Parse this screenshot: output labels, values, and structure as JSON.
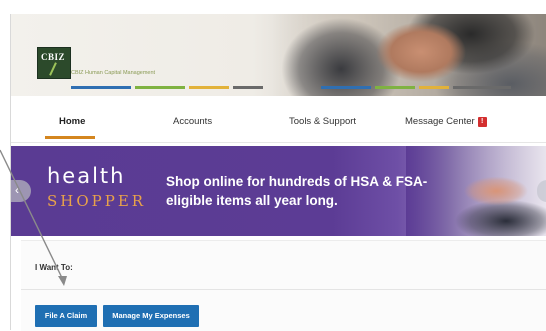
{
  "header": {
    "logo_text": "CBIZ",
    "logo_subtitle": "CBIZ Human Capital Management",
    "stripe_colors": [
      "#2f6fb2",
      "#7fb241",
      "#e2b23a",
      "#6a6a6a",
      "#2f6fb2",
      "#7fb241"
    ]
  },
  "nav": {
    "items": [
      {
        "label": "Home",
        "active": true
      },
      {
        "label": "Accounts",
        "active": false
      },
      {
        "label": "Tools & Support",
        "active": false
      },
      {
        "label": "Message Center",
        "active": false
      }
    ],
    "message_badge": "!"
  },
  "promo": {
    "title_line1": "health",
    "title_line2": "SHOPPER",
    "text": "Shop online for hundreds of HSA & FSA-eligible items all year long.",
    "prev_icon": "‹"
  },
  "iwant": {
    "label": "I Want To:",
    "buttons": [
      {
        "label": "File A Claim"
      },
      {
        "label": "Manage My Expenses"
      }
    ]
  },
  "colors": {
    "accent_orange": "#d4861f",
    "button_blue": "#1f6fb3",
    "promo_purple": "#5a3b93",
    "badge_red": "#d32f2f"
  }
}
